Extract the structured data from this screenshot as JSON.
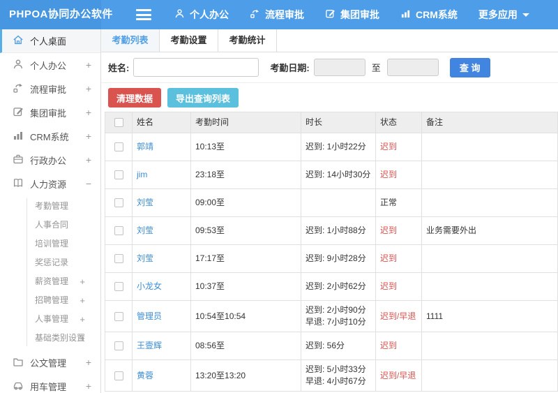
{
  "colors": {
    "header-blue": "#4d9de8",
    "header-blue-dark": "#4696e2",
    "accent": "#4f9ee6",
    "link": "#3e8ed6",
    "red": "#d9534f",
    "cyan": "#5bc0de",
    "query-blue": "#4285e0",
    "active-border": "#57aee5"
  },
  "header": {
    "app_title": "PHPOA协同办公软件",
    "nav": [
      {
        "label": "个人办公",
        "icon": "user-icon"
      },
      {
        "label": "流程审批",
        "icon": "flow-icon"
      },
      {
        "label": "集团审批",
        "icon": "edit-icon"
      },
      {
        "label": "CRM系统",
        "icon": "chart-icon"
      },
      {
        "label": "更多应用",
        "icon": "caret-down-icon"
      }
    ]
  },
  "sidebar": {
    "items": [
      {
        "label": "个人桌面",
        "icon": "home-icon",
        "active": true
      },
      {
        "label": "个人办公",
        "icon": "user-icon",
        "expand": "+"
      },
      {
        "label": "流程审批",
        "icon": "flow-icon",
        "expand": "+"
      },
      {
        "label": "集团审批",
        "icon": "edit-icon",
        "expand": "+"
      },
      {
        "label": "CRM系统",
        "icon": "chart-icon",
        "expand": "+"
      },
      {
        "label": "行政办公",
        "icon": "briefcase-icon",
        "expand": "+"
      },
      {
        "label": "人力资源",
        "icon": "book-icon",
        "expand": "−"
      }
    ],
    "hr_children": [
      {
        "label": "考勤管理"
      },
      {
        "label": "人事合同"
      },
      {
        "label": "培训管理"
      },
      {
        "label": "奖惩记录"
      },
      {
        "label": "薪资管理",
        "expand": "+"
      },
      {
        "label": "招聘管理",
        "expand": "+"
      },
      {
        "label": "人事管理",
        "expand": "+"
      },
      {
        "label": "基础类别设置",
        "expand": "+"
      }
    ],
    "items_after": [
      {
        "label": "公文管理",
        "icon": "folder-icon",
        "expand": "+"
      },
      {
        "label": "用车管理",
        "icon": "car-icon",
        "expand": "+"
      }
    ]
  },
  "tabs": [
    {
      "label": "考勤列表",
      "active": true
    },
    {
      "label": "考勤设置"
    },
    {
      "label": "考勤统计"
    }
  ],
  "filter": {
    "name_label": "姓名:",
    "name_value": "",
    "date_label": "考勤日期:",
    "date_from": "",
    "to_label": "至",
    "date_to": "",
    "query_button": "查 询"
  },
  "actions": {
    "clean_button": "清理数据",
    "export_button": "导出查询列表"
  },
  "table": {
    "columns": [
      "姓名",
      "考勤时间",
      "时长",
      "状态",
      "备注"
    ],
    "rows": [
      {
        "name": "郭靖",
        "time": "10:13至",
        "d1": "迟到: 1小时22分",
        "d2": "",
        "status": "迟到",
        "status_red": true,
        "remark": ""
      },
      {
        "name": "jim",
        "time": "23:18至",
        "d1": "迟到: 14小时30分",
        "d2": "",
        "status": "迟到",
        "status_red": true,
        "remark": ""
      },
      {
        "name": "刘莹",
        "time": "09:00至",
        "d1": "",
        "d2": "",
        "status": "正常",
        "status_red": false,
        "remark": ""
      },
      {
        "name": "刘莹",
        "time": "09:53至",
        "d1": "迟到: 1小时88分",
        "d2": "",
        "status": "迟到",
        "status_red": true,
        "remark": "业务需要外出"
      },
      {
        "name": "刘莹",
        "time": "17:17至",
        "d1": "迟到: 9小时28分",
        "d2": "",
        "status": "迟到",
        "status_red": true,
        "remark": ""
      },
      {
        "name": "小龙女",
        "time": "10:37至",
        "d1": "迟到: 2小时62分",
        "d2": "",
        "status": "迟到",
        "status_red": true,
        "remark": ""
      },
      {
        "name": "管理员",
        "time": "10:54至10:54",
        "d1": "迟到: 2小时90分",
        "d2": "早退: 7小时10分",
        "status": "迟到/早退",
        "status_red": true,
        "remark": "1111"
      },
      {
        "name": "王壹辉",
        "time": "08:56至",
        "d1": "迟到: 56分",
        "d2": "",
        "status": "迟到",
        "status_red": true,
        "remark": ""
      },
      {
        "name": "黄蓉",
        "time": "13:20至13:20",
        "d1": "迟到: 5小时33分",
        "d2": "早退: 4小时67分",
        "status": "迟到/早退",
        "status_red": true,
        "remark": ""
      }
    ]
  }
}
